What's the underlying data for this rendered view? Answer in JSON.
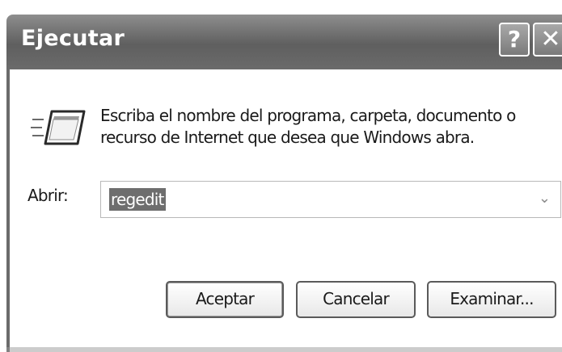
{
  "dialog": {
    "title": "Ejecutar",
    "help_button": "?",
    "close_button": "✕",
    "description_line1": "Escriba el nombre del programa, carpeta, documento o",
    "description_line2": "recurso de Internet que desea que Windows abra.",
    "open_label": "Abrir:",
    "open_value": "regedit",
    "dropdown_arrow": "⌄",
    "buttons": {
      "ok": "Aceptar",
      "cancel": "Cancelar",
      "browse": "Examinar..."
    }
  },
  "icons": {
    "program": "run-program-icon"
  }
}
